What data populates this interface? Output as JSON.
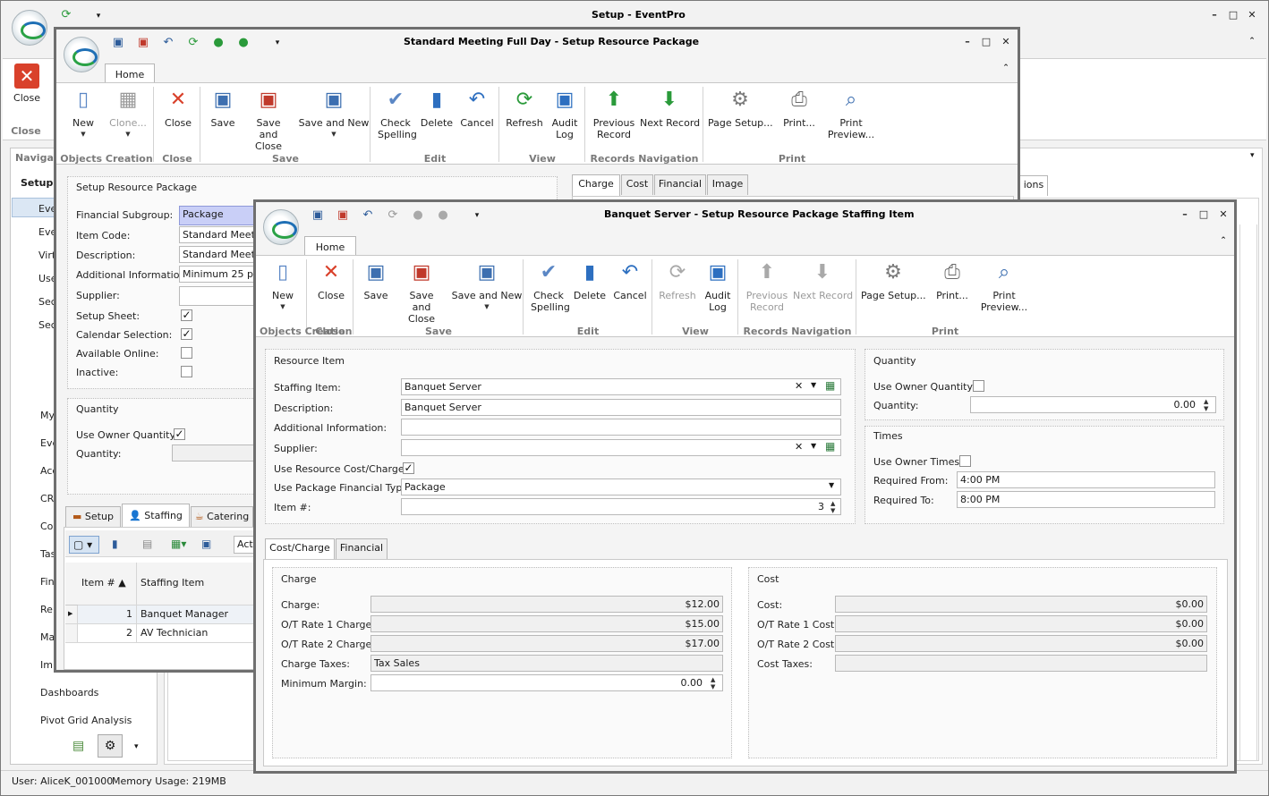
{
  "main": {
    "title": "Setup - EventPro",
    "close_label": "Close",
    "close_group": "Close",
    "nav_header": "Navigat",
    "nav_section": "Setup",
    "nav_items_top": [
      "Eve",
      "Eve",
      "Virt",
      "Use",
      "Sec",
      "Sec"
    ],
    "nav_items_bottom": [
      "My",
      "Eve",
      "Acc",
      "CR",
      "Co",
      "Tas",
      "Fin",
      "Re",
      "Ma",
      "Imp",
      "Dashboards",
      "Pivot Grid Analysis"
    ],
    "bg_tab_partial": "ions",
    "status_user": "User: AliceK_001000",
    "status_memory": "Memory Usage: 219MB"
  },
  "pkg": {
    "title": "Standard Meeting Full Day - Setup Resource Package",
    "home_tab": "Home",
    "ribbon": {
      "new": "New",
      "clone": "Clone...",
      "close": "Close",
      "save": "Save",
      "save_close": "Save and Close",
      "save_new": "Save and New",
      "check_spelling": "Check Spelling",
      "delete": "Delete",
      "cancel": "Cancel",
      "refresh": "Refresh",
      "audit_log": "Audit Log",
      "prev_record": "Previous Record",
      "next_record": "Next Record",
      "page_setup": "Page Setup...",
      "print": "Print...",
      "print_preview": "Print Preview..."
    },
    "groups": {
      "objects": "Objects Creation",
      "close": "Close",
      "save": "Save",
      "edit": "Edit",
      "view": "View",
      "nav": "Records Navigation",
      "print": "Print"
    },
    "section_title": "Setup Resource Package",
    "labels": {
      "subgroup": "Financial Subgroup:",
      "item_code": "Item Code:",
      "description": "Description:",
      "additional": "Additional Information:",
      "supplier": "Supplier:",
      "setup_sheet": "Setup Sheet:",
      "calendar": "Calendar Selection:",
      "available": "Available Online:",
      "inactive": "Inactive:"
    },
    "values": {
      "subgroup": "Package",
      "item_code": "Standard Meetin",
      "description": "Standard Meetin",
      "additional": "Minimum 25 peop",
      "supplier": ""
    },
    "checks": {
      "setup_sheet": "✓",
      "calendar": "✓",
      "available": "",
      "inactive": ""
    },
    "quantity_title": "Quantity",
    "use_owner_qty": "Use Owner Quantity:",
    "use_owner_qty_check": "✓",
    "qty_label": "Quantity:",
    "right_tabs": [
      "Charge",
      "Cost",
      "Financial",
      "Image"
    ],
    "bottom_tabs": [
      "Setup",
      "Staffing",
      "Catering"
    ],
    "toolbar_partial": "Acti",
    "grid_headers": [
      "Item #",
      "Staffing Item"
    ],
    "grid_rows": [
      {
        "num": "1",
        "item": "Banquet Manager"
      },
      {
        "num": "2",
        "item": "AV Technician"
      }
    ]
  },
  "staff": {
    "title": "Banquet Server - Setup Resource Package Staffing Item",
    "home_tab": "Home",
    "ribbon": {
      "new": "New",
      "close": "Close",
      "save": "Save",
      "save_close": "Save and Close",
      "save_new": "Save and New",
      "check_spelling": "Check Spelling",
      "delete": "Delete",
      "cancel": "Cancel",
      "refresh": "Refresh",
      "audit_log": "Audit Log",
      "prev_record": "Previous Record",
      "next_record": "Next Record",
      "page_setup": "Page Setup...",
      "print": "Print...",
      "print_preview": "Print Preview..."
    },
    "groups": {
      "objects": "Objects Creation",
      "close": "Close",
      "save": "Save",
      "edit": "Edit",
      "view": "View",
      "nav": "Records Navigation",
      "print": "Print"
    },
    "resource_title": "Resource Item",
    "labels": {
      "staffing_item": "Staffing Item:",
      "description": "Description:",
      "additional": "Additional Information:",
      "supplier": "Supplier:",
      "use_cost": "Use Resource Cost/Charge:",
      "use_fin_type": "Use Package Financial Type:",
      "item_num": "Item #:"
    },
    "values": {
      "staffing_item": "Banquet Server",
      "description": "Banquet Server",
      "additional": "",
      "supplier": "",
      "use_cost_check": "✓",
      "fin_type": "Package",
      "item_num": "3"
    },
    "quantity_title": "Quantity",
    "use_owner_qty": "Use Owner Quantity:",
    "use_owner_qty_check": "",
    "qty_label": "Quantity:",
    "qty_value": "0.00",
    "times_title": "Times",
    "use_owner_times": "Use Owner Times:",
    "use_owner_times_check": "",
    "req_from_label": "Required From:",
    "req_from": "4:00 PM",
    "req_to_label": "Required To:",
    "req_to": "8:00 PM",
    "tabs": [
      "Cost/Charge",
      "Financial"
    ],
    "charge_title": "Charge",
    "charge_labels": {
      "charge": "Charge:",
      "ot1": "O/T Rate 1 Charge:",
      "ot2": "O/T Rate 2 Charge:",
      "taxes": "Charge Taxes:",
      "margin": "Minimum Margin:"
    },
    "charge_values": {
      "charge": "$12.00",
      "ot1": "$15.00",
      "ot2": "$17.00",
      "taxes": "Tax Sales",
      "margin": "0.00"
    },
    "cost_title": "Cost",
    "cost_labels": {
      "cost": "Cost:",
      "ot1": "O/T Rate 1 Cost:",
      "ot2": "O/T Rate 2 Cost:",
      "taxes": "Cost Taxes:"
    },
    "cost_values": {
      "cost": "$0.00",
      "ot1": "$0.00",
      "ot2": "$0.00",
      "taxes": ""
    }
  }
}
